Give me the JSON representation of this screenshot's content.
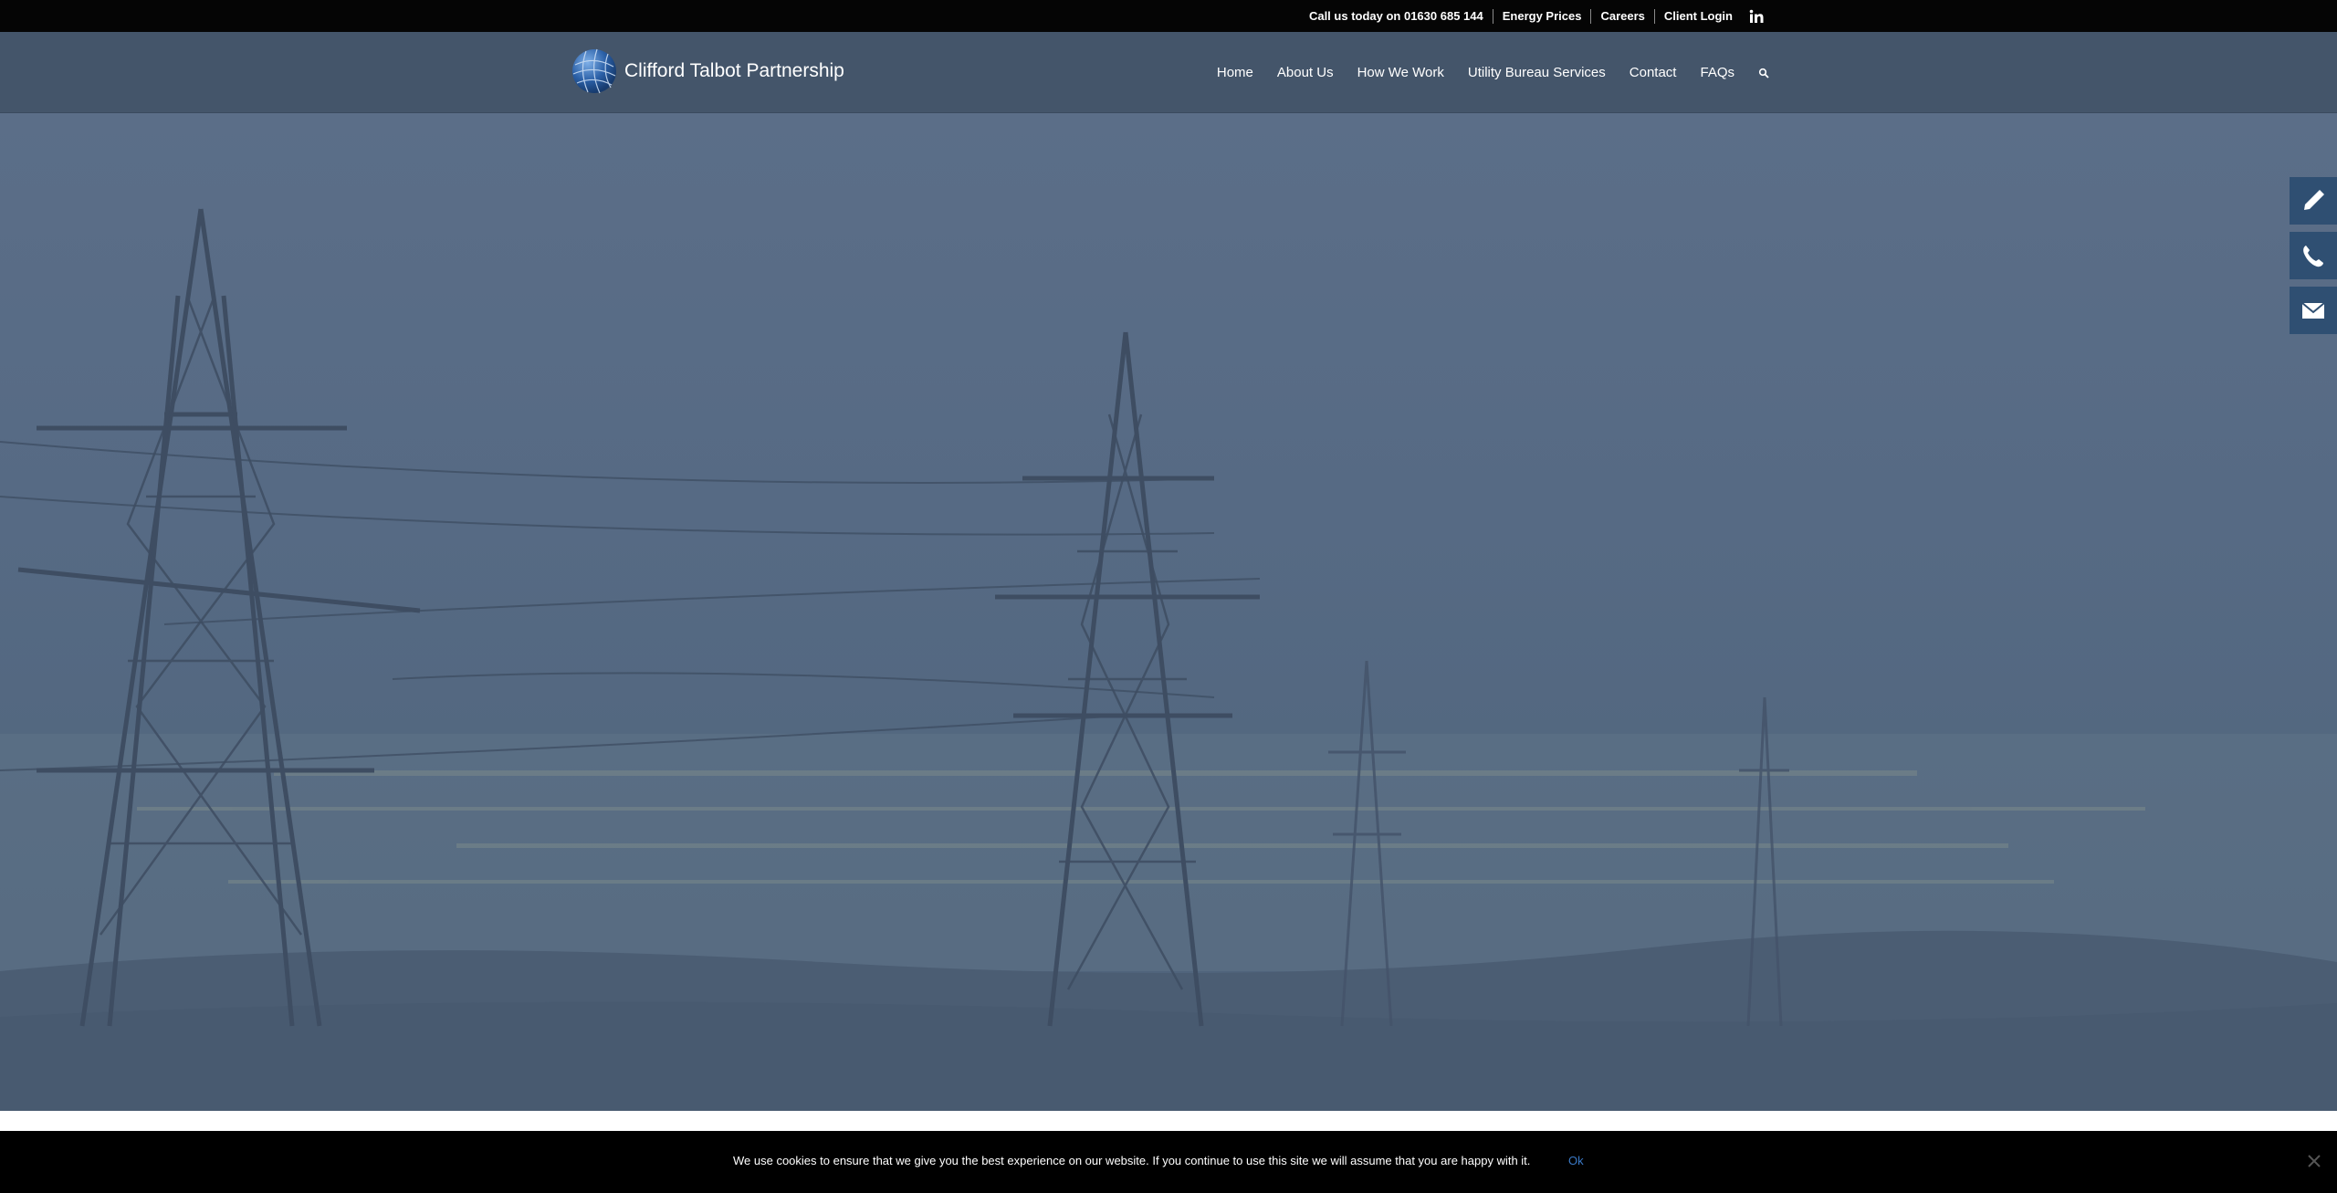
{
  "topbar": {
    "phone_text": "Call us today on 01630 685 144",
    "links": [
      "Energy Prices",
      "Careers",
      "Client Login"
    ],
    "social_icon": "linkedin-icon"
  },
  "header": {
    "brand": "Clifford Talbot Partnership",
    "logo_icon": "globe-icon",
    "nav": [
      "Home",
      "About Us",
      "How We Work",
      "Utility Bureau Services",
      "Contact",
      "FAQs"
    ],
    "search_icon": "search-icon"
  },
  "side_buttons": [
    "pencil-icon",
    "phone-icon",
    "mail-icon"
  ],
  "cookie": {
    "message": "We use cookies to ensure that we give you the best experience on our website. If you continue to use this site we will assume that you are happy with it.",
    "ok_label": "Ok",
    "close_icon": "close-icon"
  },
  "colors": {
    "topbar_bg": "#050505",
    "header_bg": "#44556a",
    "hero_bg": "#566a84",
    "side_button_bg": "#2f4f72",
    "cookie_ok": "#3a79c6"
  }
}
